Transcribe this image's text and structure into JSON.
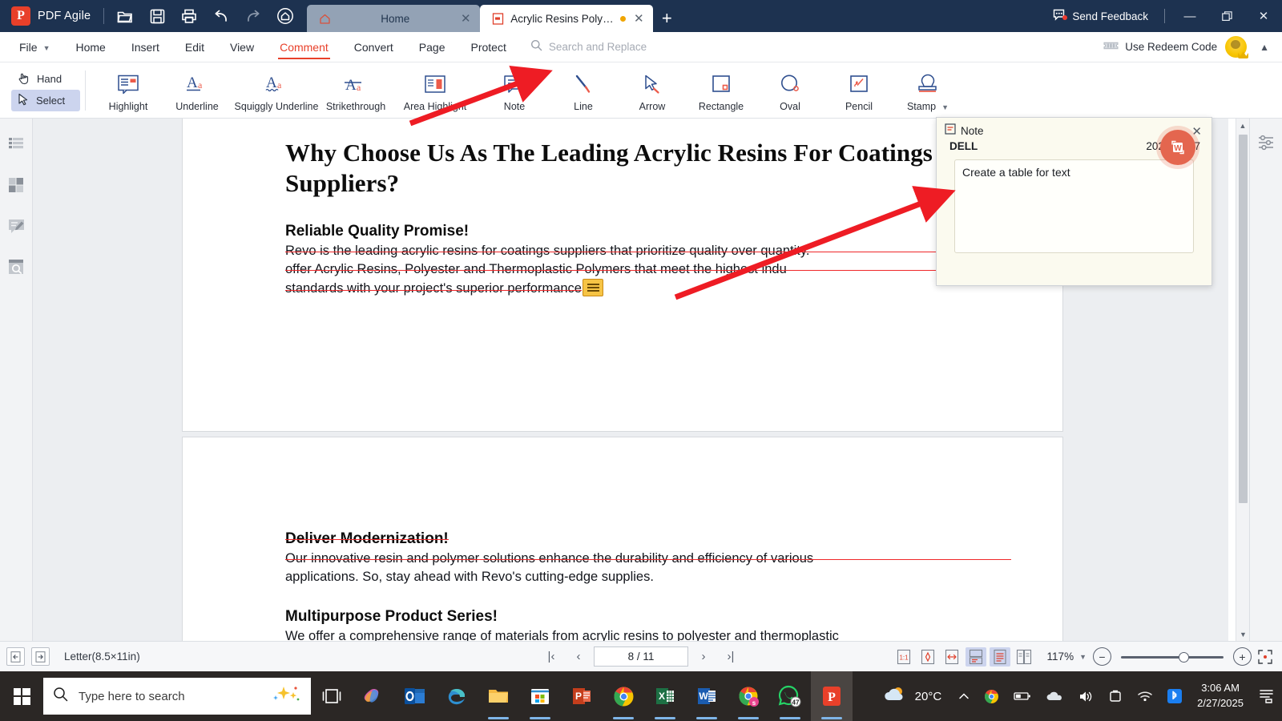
{
  "titlebar": {
    "brand": "PDF Agile",
    "quick_tools": [
      {
        "name": "open-file-icon",
        "label": "Open"
      },
      {
        "name": "save-icon",
        "label": "Save"
      },
      {
        "name": "print-icon",
        "label": "Print"
      },
      {
        "name": "undo-icon",
        "label": "Undo"
      },
      {
        "name": "redo-icon",
        "label": "Redo"
      },
      {
        "name": "home-icon",
        "label": "Home"
      }
    ],
    "tabs": [
      {
        "label": "Home",
        "active": false,
        "icon": "home-icon",
        "modified": false
      },
      {
        "label": "Acrylic Resins  Polyester a...",
        "active": true,
        "icon": "pdf-file-icon",
        "modified": true
      }
    ],
    "new_tab_label": "+",
    "feedback_label": "Send Feedback",
    "window_buttons": {
      "minimize": "—",
      "maximize": "❐",
      "close": "✕"
    }
  },
  "menubar": {
    "items": [
      {
        "label": "File",
        "active": false,
        "has_caret": true
      },
      {
        "label": "Home",
        "active": false,
        "has_caret": false
      },
      {
        "label": "Insert",
        "active": false,
        "has_caret": false
      },
      {
        "label": "Edit",
        "active": false,
        "has_caret": false
      },
      {
        "label": "View",
        "active": false,
        "has_caret": false
      },
      {
        "label": "Comment",
        "active": true,
        "has_caret": false
      },
      {
        "label": "Convert",
        "active": false,
        "has_caret": false
      },
      {
        "label": "Page",
        "active": false,
        "has_caret": false
      },
      {
        "label": "Protect",
        "active": false,
        "has_caret": false
      }
    ],
    "search_placeholder": "Search and Replace",
    "redeem_label": "Use Redeem Code"
  },
  "ribbon": {
    "modes": [
      {
        "label": "Hand",
        "selected": false,
        "icon": "hand-icon"
      },
      {
        "label": "Select",
        "selected": true,
        "icon": "cursor-icon"
      }
    ],
    "tools": [
      {
        "label": "Highlight",
        "icon": "highlight-icon"
      },
      {
        "label": "Underline",
        "icon": "underline-icon"
      },
      {
        "label": "Squiggly Underline",
        "icon": "squiggly-underline-icon"
      },
      {
        "label": "Strikethrough",
        "icon": "strikethrough-icon"
      },
      {
        "label": "Area Highlight",
        "icon": "area-highlight-icon"
      },
      {
        "label": "Note",
        "icon": "note-icon"
      },
      {
        "label": "Line",
        "icon": "line-icon"
      },
      {
        "label": "Arrow",
        "icon": "arrow-icon"
      },
      {
        "label": "Rectangle",
        "icon": "rectangle-icon"
      },
      {
        "label": "Oval",
        "icon": "oval-icon"
      },
      {
        "label": "Pencil",
        "icon": "pencil-icon"
      },
      {
        "label": "Stamp",
        "icon": "stamp-icon",
        "has_caret": true
      }
    ]
  },
  "left_rail": [
    {
      "name": "thumbnails-panel-icon"
    },
    {
      "name": "page-grid-icon"
    },
    {
      "name": "comments-panel-icon"
    },
    {
      "name": "search-panel-icon"
    }
  ],
  "document": {
    "title": "Why Choose Us As The Leading Acrylic Resins For Coatings Suppliers?",
    "sections": [
      {
        "heading": "Reliable Quality Promise!",
        "heading_struck": false,
        "lines": [
          {
            "text": "Revo is the leading acrylic resins for coatings suppliers that prioritize quality over quantity.",
            "struck": true
          },
          {
            "text": "offer Acrylic Resins, Polyester and Thermoplastic Polymers that meet the highest indu",
            "struck": true
          },
          {
            "text": "standards with your project's superior performance",
            "struck": true,
            "has_note_marker": true
          }
        ]
      },
      {
        "heading": "Deliver Modernization!",
        "heading_struck": true,
        "lines": [
          {
            "text": "Our innovative resin and polymer solutions enhance the durability and  efficiency of various",
            "struck": true
          },
          {
            "text": "applications. So, stay ahead with Revo's cutting-edge supplies.",
            "struck": false
          }
        ]
      },
      {
        "heading": "Multipurpose Product Series!",
        "heading_struck": false,
        "lines": [
          {
            "text": "We offer a comprehensive range of materials from acrylic resins to polyester and thermoplastic",
            "struck": false
          }
        ]
      }
    ]
  },
  "note_popup": {
    "title": "Note",
    "author": "DELL",
    "date": "2025/02/27",
    "body": "Create a table for text",
    "close_label": "✕"
  },
  "convert_fab": {
    "name": "pdf-to-word-button",
    "glyph": "W"
  },
  "statusbar": {
    "prev_view_label": "←",
    "next_view_label": "→",
    "page_size": "Letter(8.5×11in)",
    "page_indicator": "8 / 11",
    "first_page": "|‹",
    "prev_page": "‹",
    "next_page": "›",
    "last_page": "›|",
    "view_buttons": [
      {
        "name": "actual-size-icon",
        "label": "1:1",
        "selected": false
      },
      {
        "name": "fit-page-icon",
        "label": "",
        "selected": false
      },
      {
        "name": "fit-width-icon",
        "label": "",
        "selected": false
      },
      {
        "name": "continuous-scroll-icon",
        "label": "",
        "selected": true
      },
      {
        "name": "single-page-icon",
        "label": "",
        "selected": true
      },
      {
        "name": "two-page-icon",
        "label": "",
        "selected": false
      }
    ],
    "zoom_level": "117%",
    "zoom_out": "−",
    "zoom_in": "+",
    "fullscreen_label": "fullscreen-icon"
  },
  "taskbar": {
    "search_placeholder": "Type here to search",
    "apps": [
      {
        "name": "task-view-icon",
        "glyph": "",
        "running": false
      },
      {
        "name": "copilot-icon",
        "glyph": "",
        "running": false
      },
      {
        "name": "outlook-icon",
        "glyph": "O",
        "running": false
      },
      {
        "name": "edge-icon",
        "glyph": "",
        "running": false
      },
      {
        "name": "file-explorer-icon",
        "glyph": "",
        "running": true
      },
      {
        "name": "microsoft-store-icon",
        "glyph": "",
        "running": true
      },
      {
        "name": "powerpoint-icon",
        "glyph": "P",
        "running": false
      },
      {
        "name": "chrome-icon",
        "glyph": "",
        "running": true
      },
      {
        "name": "excel-icon",
        "glyph": "X",
        "running": true
      },
      {
        "name": "word-icon",
        "glyph": "W",
        "running": true
      },
      {
        "name": "chrome-beta-icon",
        "glyph": "",
        "running": true
      },
      {
        "name": "whatsapp-icon",
        "glyph": "",
        "badge": "47",
        "running": true
      },
      {
        "name": "pdf-agile-taskbar-icon",
        "glyph": "P",
        "running": true,
        "active": true
      }
    ],
    "weather": {
      "temperature": "20°C",
      "icon": "partly-cloudy-icon"
    },
    "tray": [
      {
        "name": "show-hidden-icons-chevron",
        "glyph": "⌃"
      },
      {
        "name": "chrome-tray-icon",
        "glyph": ""
      },
      {
        "name": "battery-icon",
        "glyph": ""
      },
      {
        "name": "onedrive-icon",
        "glyph": ""
      },
      {
        "name": "volume-icon",
        "glyph": ""
      },
      {
        "name": "screen-record-icon",
        "glyph": ""
      },
      {
        "name": "wifi-icon",
        "glyph": ""
      },
      {
        "name": "bluetooth-icon",
        "glyph": ""
      }
    ],
    "clock_time": "3:06 AM",
    "clock_date": "2/27/2025",
    "notification_icon": "action-center-icon"
  },
  "colors": {
    "titlebar_bg": "#1d3250",
    "brand_red": "#e8402a",
    "accent_red": "#f0282a",
    "selected_blue": "#ccd4ee",
    "note_bg": "#fbfaef",
    "taskbar_bg": "#2b2725"
  }
}
